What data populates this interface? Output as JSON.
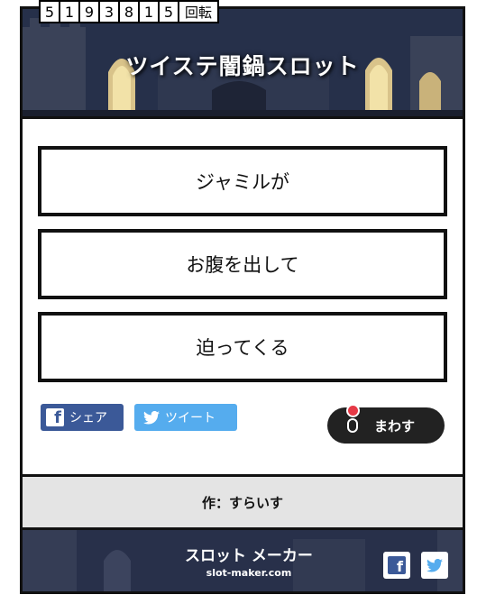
{
  "counter": {
    "digits": [
      "5",
      "1",
      "9",
      "3",
      "8",
      "1",
      "5"
    ],
    "unit": "回転"
  },
  "banner": {
    "title": "ツイステ闇鍋スロット"
  },
  "reels": [
    "ジャミルが",
    "お腹を出して",
    "迫ってくる"
  ],
  "buttons": {
    "share": "シェア",
    "tweet": "ツイート",
    "spin": "まわす"
  },
  "author": "作：すらいす",
  "footer": {
    "logo_main": "スロット メーカー",
    "logo_url": "slot-maker.com"
  },
  "colors": {
    "facebook": "#3b5998",
    "twitter": "#55acee",
    "spin_button": "#222222",
    "lever_ball": "#e63946",
    "author_bg": "#e4e4e4"
  },
  "icons": [
    "facebook-icon",
    "twitter-icon",
    "lever-icon"
  ]
}
